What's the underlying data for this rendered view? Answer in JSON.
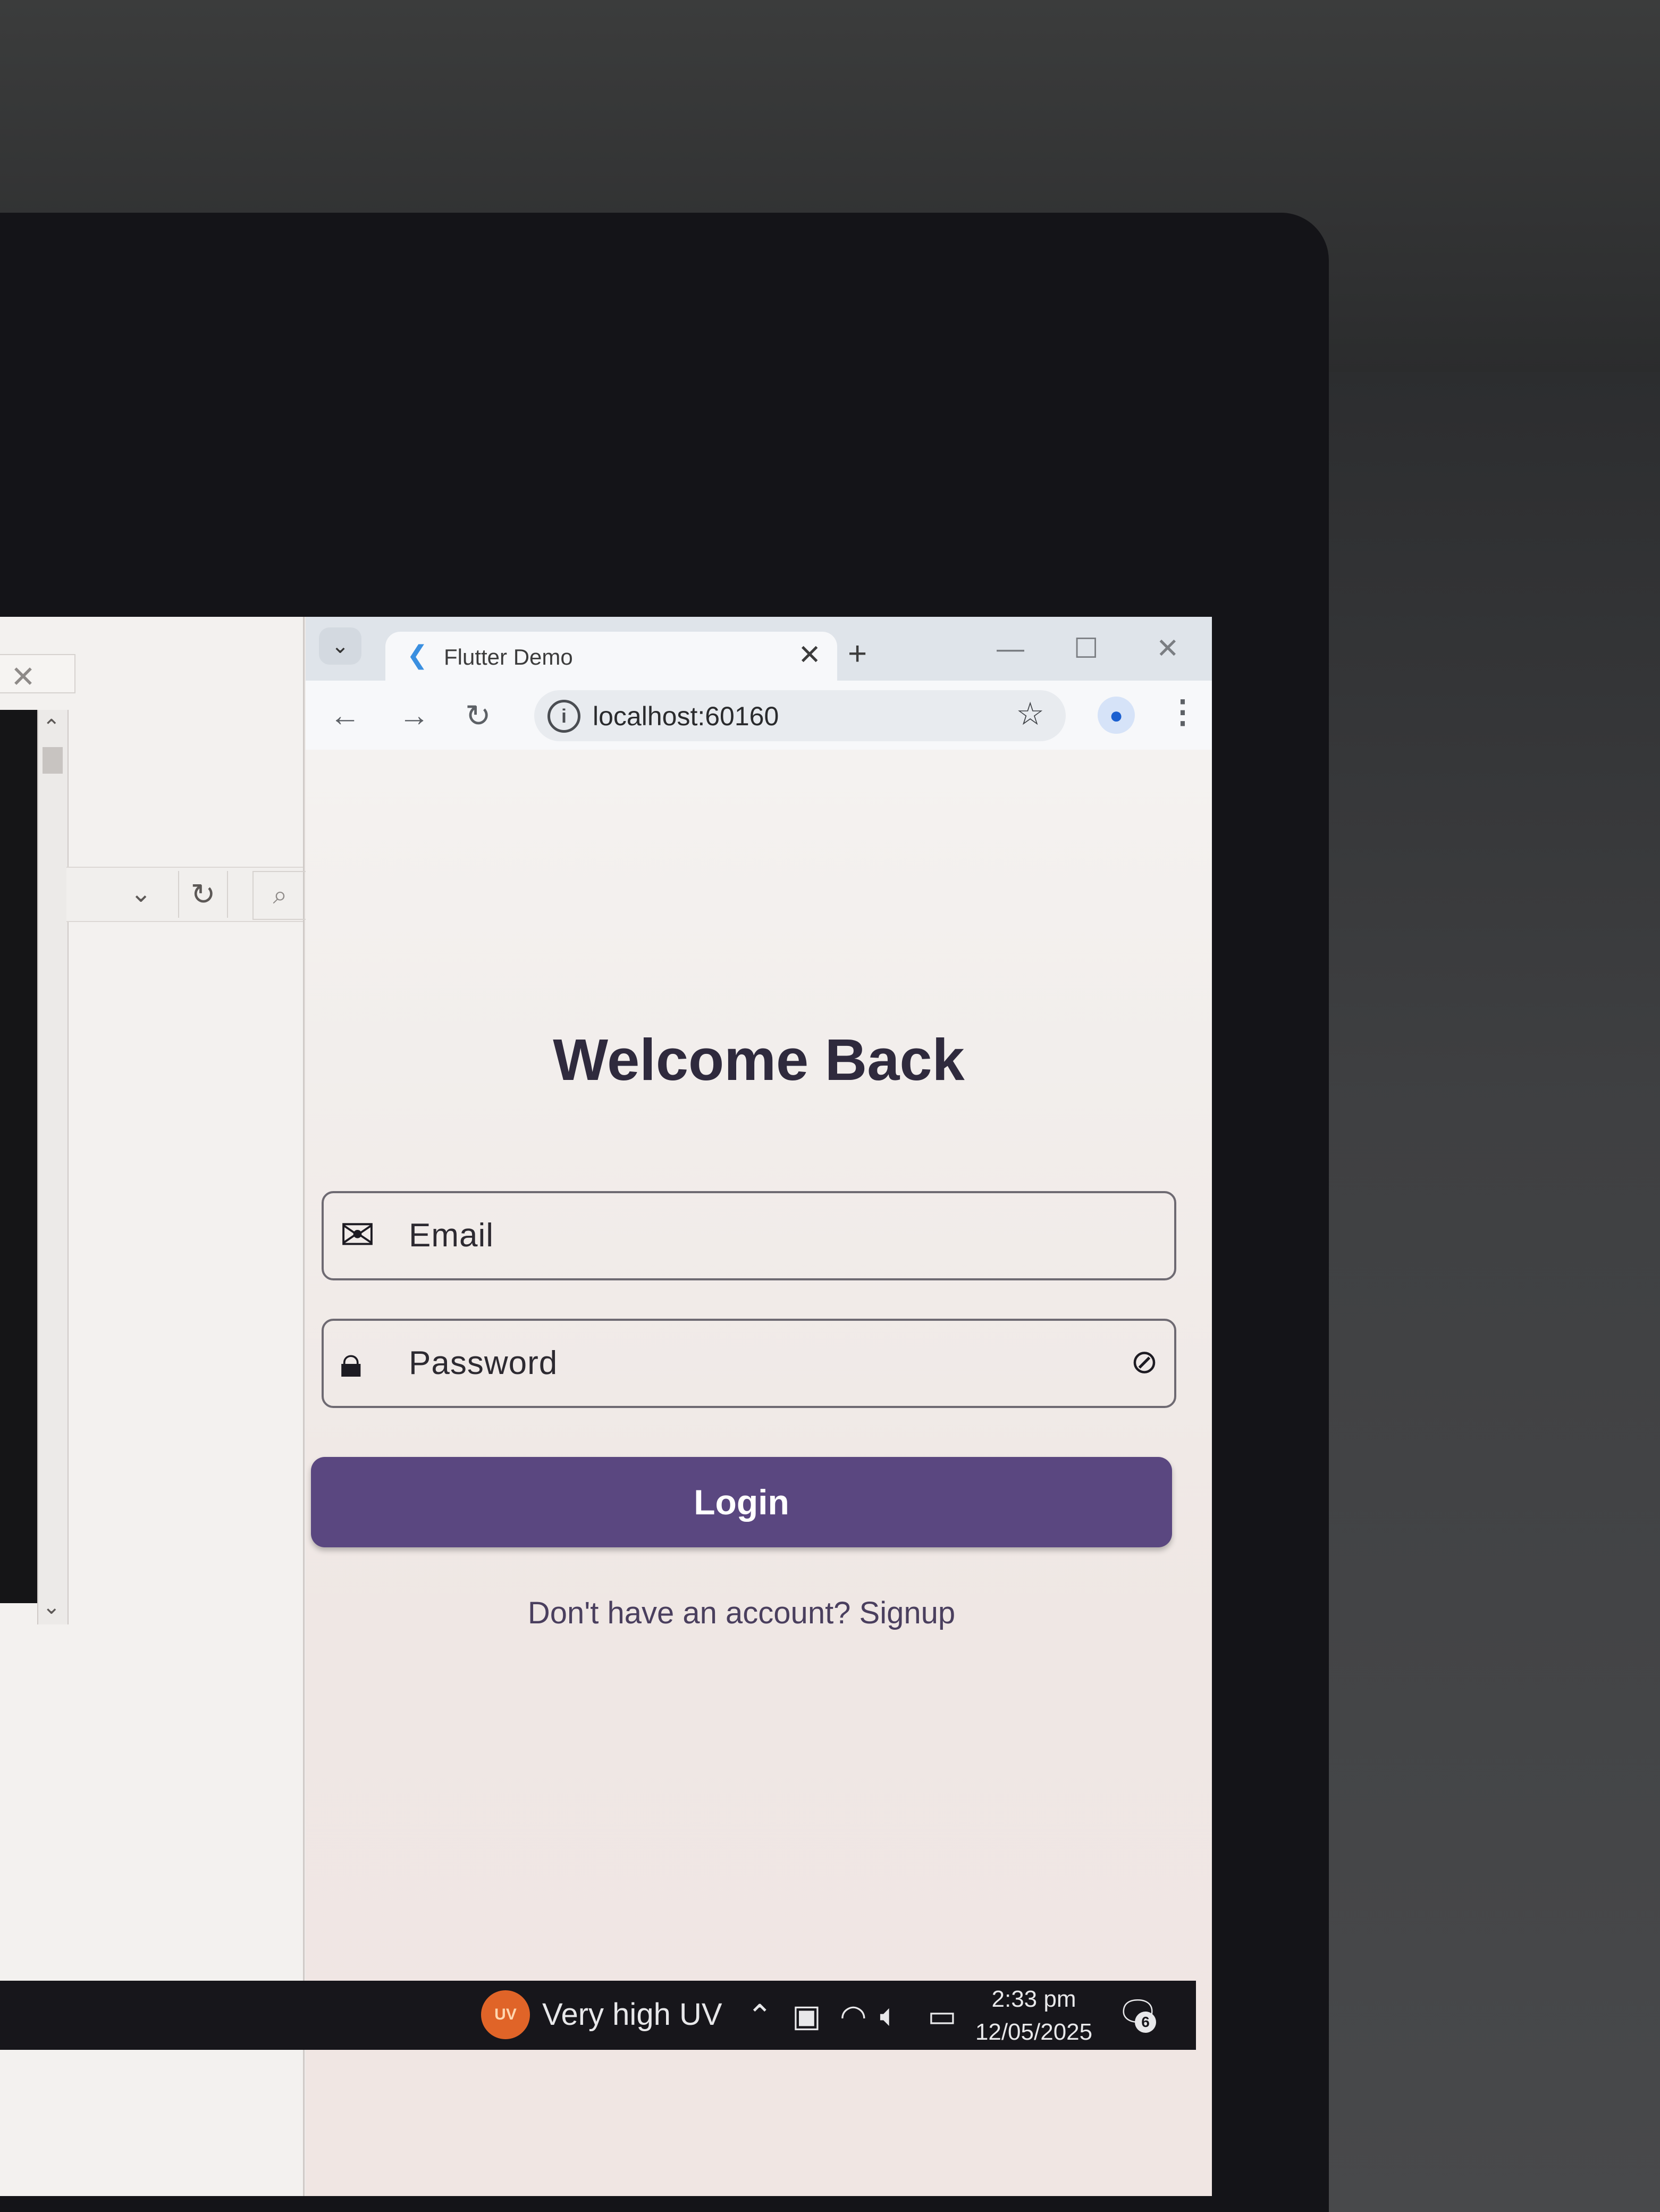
{
  "browser": {
    "tab_title": "Flutter Demo",
    "new_tab": "+",
    "url": "localhost:60160"
  },
  "app": {
    "heading": "Welcome Back",
    "email_placeholder": "Email",
    "password_placeholder": "Password",
    "login_label": "Login",
    "signup_prompt": "Don't have an account? Signup",
    "accent_color": "#5a4780"
  },
  "taskbar": {
    "weather_badge": "UV",
    "weather_text": "Very high UV",
    "time": "2:33 pm",
    "date": "12/05/2025",
    "notification_count": "6"
  },
  "icons": [
    "chevron-down-icon",
    "flutter-icon",
    "close-icon",
    "plus-icon",
    "back-icon",
    "forward-icon",
    "reload-icon",
    "info-icon",
    "star-icon",
    "profile-icon",
    "kebab-icon",
    "mail-icon",
    "lock-icon",
    "visibility-off-icon",
    "chevron-up-icon",
    "wifi-icon",
    "volume-icon",
    "battery-icon",
    "notification-icon"
  ]
}
